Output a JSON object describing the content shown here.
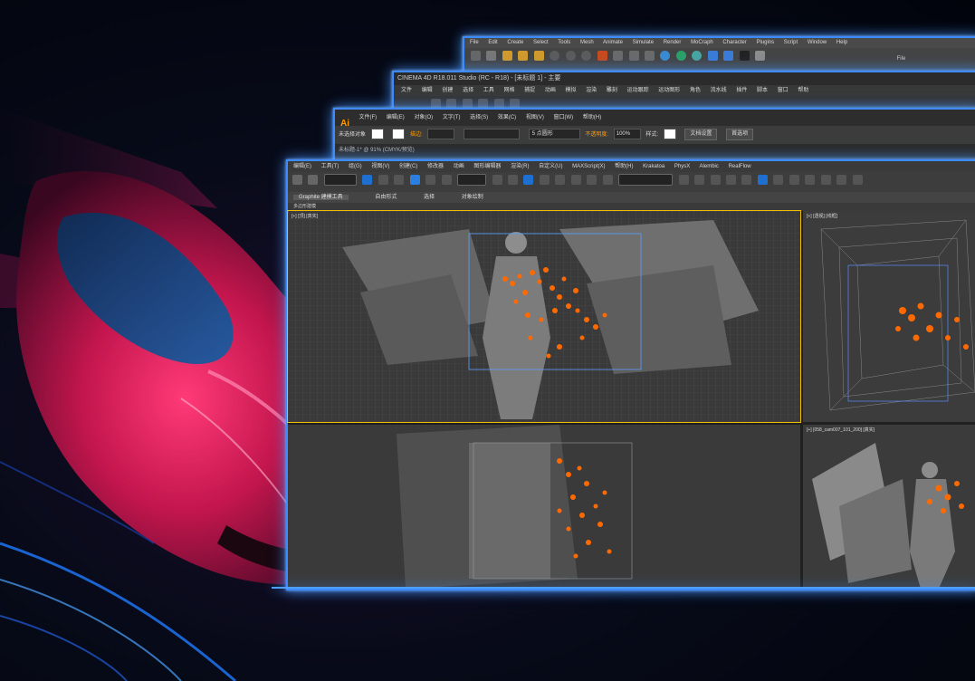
{
  "maya": {
    "menu": [
      "File",
      "Edit",
      "Create",
      "Select",
      "Tools",
      "Mesh",
      "Animate",
      "Simulate",
      "Render",
      "MoCraph",
      "Character",
      "Plugins",
      "Script",
      "Window",
      "Help"
    ],
    "right_label": "File"
  },
  "c4d": {
    "title": "CINEMA 4D R18.011 Studio (RC - R18) - [未标题 1] - 主要",
    "menu": [
      "文件",
      "编辑",
      "创建",
      "选择",
      "工具",
      "网格",
      "捕捉",
      "动画",
      "模拟",
      "渲染",
      "雕刻",
      "运动跟踪",
      "运动图形",
      "角色",
      "流水线",
      "插件",
      "脚本",
      "窗口",
      "帮助"
    ]
  },
  "ai": {
    "logo": "Ai",
    "menu": [
      "文件(F)",
      "编辑(E)",
      "对象(O)",
      "文字(T)",
      "选择(S)",
      "效果(C)",
      "视图(V)",
      "窗口(W)",
      "帮助(H)"
    ],
    "control": {
      "no_selection": "未选择对象",
      "stroke_label": "描边:",
      "point_value": "5 点圆形",
      "opacity_label": "不透明度:",
      "opacity_value": "100%",
      "style_label": "样式:",
      "doc_setup": "文档设置",
      "preferences": "首选项"
    },
    "doc_tab": "未标题-1* @ 91% (CMYK/预览)"
  },
  "max": {
    "menu": [
      "编辑(E)",
      "工具(T)",
      "组(G)",
      "视图(V)",
      "创建(C)",
      "修改器",
      "动画",
      "图形编辑器",
      "渲染(R)",
      "自定义(U)",
      "MAXScript(X)",
      "帮助(H)",
      "Krakatoa",
      "PhysX",
      "Alembic",
      "RealFlow"
    ],
    "ribbon": [
      "Graphite 建模工具",
      "自由形式",
      "选择",
      "对象绘制"
    ],
    "subbar": "多边形建模",
    "viewports": {
      "top_left": "[+] [顶] [真实]",
      "top_right": "[+] [透视] [线框]",
      "bottom_right": "[+] [058_cam007_101_200] [真实]"
    }
  },
  "colors": {
    "window_glow": "#3d8bff",
    "particles": "#ff6a00",
    "car": "#c4164e"
  }
}
